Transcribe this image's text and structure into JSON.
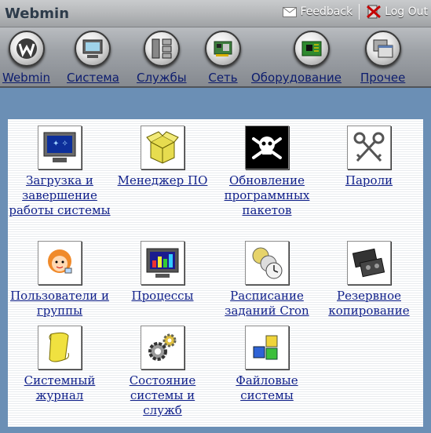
{
  "topbar": {
    "brand": "Webmin",
    "feedback_label": "Feedback",
    "logout_label": "Log Out"
  },
  "nav": {
    "items": [
      {
        "label": "Webmin",
        "icon": "webmin-logo-icon"
      },
      {
        "label": "Система",
        "icon": "monitor-icon"
      },
      {
        "label": "Службы",
        "icon": "services-icon"
      },
      {
        "label": "Сеть",
        "icon": "network-card-icon"
      },
      {
        "label": "Оборудование",
        "icon": "circuit-board-icon"
      },
      {
        "label": "Прочее",
        "icon": "windows-icon"
      }
    ]
  },
  "modules": [
    {
      "label": "Загрузка и завершение работы системы",
      "icon": "monitor-stars-icon"
    },
    {
      "label": "Менеджер ПО",
      "icon": "package-box-icon"
    },
    {
      "label": "Обновление программных пакетов",
      "icon": "skull-crossbones-icon"
    },
    {
      "label": "Пароли",
      "icon": "keys-icon"
    },
    {
      "label": "Пользователи и группы",
      "icon": "user-face-icon"
    },
    {
      "label": "Процессы",
      "icon": "process-monitor-icon"
    },
    {
      "label": "Расписание заданий Cron",
      "icon": "clocks-icon"
    },
    {
      "label": "Резервное копирование",
      "icon": "tape-cartridge-icon"
    },
    {
      "label": "Системный журнал",
      "icon": "scroll-icon"
    },
    {
      "label": "Состояние системы и служб",
      "icon": "gears-icon"
    },
    {
      "label": "Файловые системы",
      "icon": "cubes-icon"
    }
  ]
}
